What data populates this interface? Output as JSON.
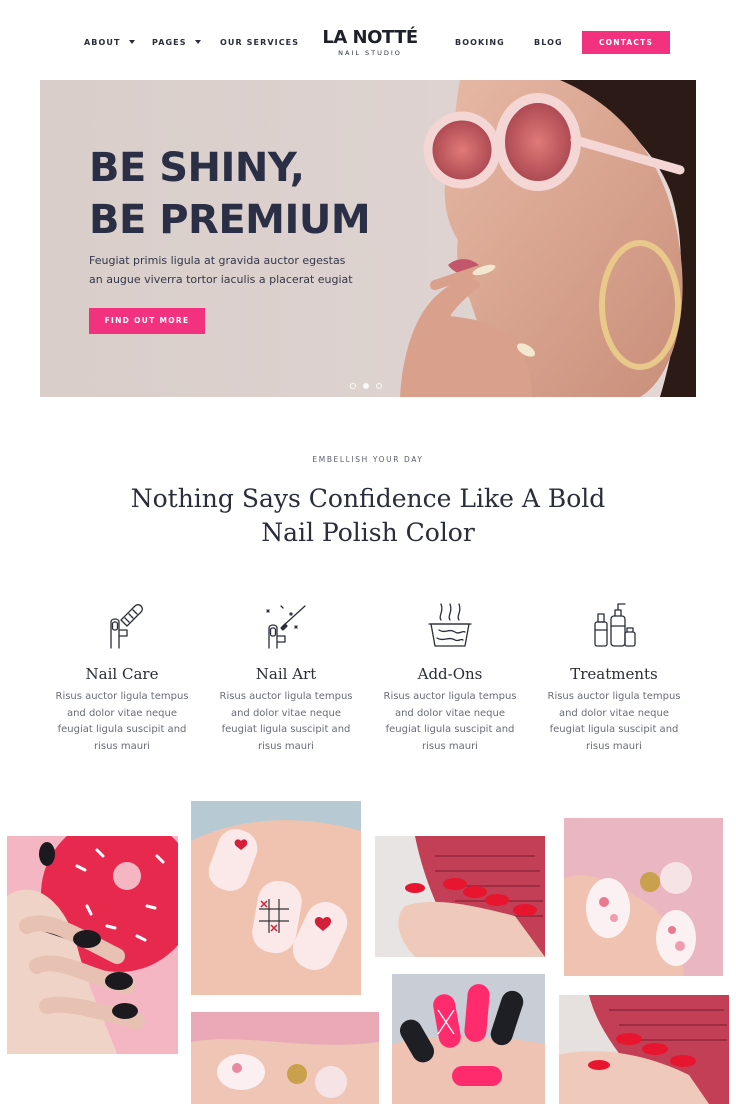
{
  "nav": {
    "items_left": [
      {
        "label": "ABOUT",
        "dropdown": true
      },
      {
        "label": "PAGES",
        "dropdown": true
      },
      {
        "label": "OUR SERVICES",
        "dropdown": false
      }
    ],
    "items_right": [
      {
        "label": "BOOKING"
      },
      {
        "label": "BLOG"
      }
    ],
    "logo_main": "LA NOTTÉ",
    "logo_sub": "NAIL STUDIO",
    "contacts_label": "CONTACTS"
  },
  "hero": {
    "title_line1": "BE SHINY,",
    "title_line2": "BE PREMIUM",
    "text": "Feugiat primis ligula at gravida auctor egestas an augue viverra tortor iaculis a placerat eugiat",
    "button_label": "FIND OUT MORE",
    "slides_total": 3,
    "slide_active": 2
  },
  "section": {
    "eyebrow": "EMBELLISH YOUR DAY",
    "headline": "Nothing Says Confidence Like A Bold Nail Polish Color"
  },
  "features": [
    {
      "icon": "nail-file-icon",
      "title": "Nail Care",
      "text": "Risus auctor ligula tempus and dolor vitae neque feugiat ligula suscipit and risus mauri"
    },
    {
      "icon": "nail-brush-icon",
      "title": "Nail Art",
      "text": "Risus auctor ligula tempus and dolor vitae neque feugiat ligula suscipit and risus mauri"
    },
    {
      "icon": "spa-bowl-icon",
      "title": "Add-Ons",
      "text": "Risus auctor ligula tempus and dolor vitae neque feugiat ligula suscipit and risus mauri"
    },
    {
      "icon": "cosmetic-bottles-icon",
      "title": "Treatments",
      "text": "Risus auctor ligula tempus and dolor vitae neque feugiat ligula suscipit and risus mauri"
    }
  ],
  "colors": {
    "accent": "#f2327e",
    "text_dark": "#2a2d3a",
    "hero_bg": "#dad0cc"
  }
}
